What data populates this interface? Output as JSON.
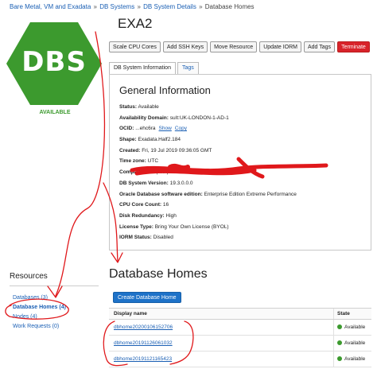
{
  "breadcrumb": {
    "items": [
      "Bare Metal, VM and Exadata",
      "DB Systems",
      "DB System Details",
      "Database Homes"
    ],
    "separator": "»"
  },
  "logo": {
    "text": "DBS",
    "state": "AVAILABLE",
    "color": "#3c9a2e"
  },
  "page_title": "EXA2",
  "toolbar": {
    "scale_cpu": "Scale CPU Cores",
    "add_ssh": "Add SSH Keys",
    "move_resource": "Move Resource",
    "update_iorm": "Update IORM",
    "add_tags": "Add Tags",
    "terminate": "Terminate"
  },
  "tabs": {
    "info": "DB System Information",
    "tags": "Tags"
  },
  "general": {
    "heading": "General Information",
    "rows": [
      {
        "key": "Status:",
        "value": "Available"
      },
      {
        "key": "Availability Domain:",
        "value": "suIt:UK-LONDON-1-AD-1"
      },
      {
        "key": "OCID:",
        "value": "...ehc6ra"
      },
      {
        "key": "Shape:",
        "value": "Exadata.Half2.184"
      },
      {
        "key": "Created:",
        "value": "Fri, 19 Jul 2019 09:36:05 GMT"
      },
      {
        "key": "Time zone:",
        "value": "UTC"
      },
      {
        "key": "Compartment:",
        "value": "(root)/"
      },
      {
        "key": "DB System Version:",
        "value": "19.3.0.0.0"
      },
      {
        "key": "Oracle Database software edition:",
        "value": "Enterprise Edition Extreme Performance"
      },
      {
        "key": "CPU Core Count:",
        "value": "16"
      },
      {
        "key": "Disk Redundancy:",
        "value": "High"
      },
      {
        "key": "License Type:",
        "value": "Bring Your Own License (BYOL)"
      },
      {
        "key": "IORM Status:",
        "value": "Disabled"
      }
    ],
    "ocid_show": "Show",
    "ocid_copy": "Copy"
  },
  "resources": {
    "title": "Resources",
    "items": [
      "Databases (3)",
      "Database Homes (4)",
      "Nodes (4)",
      "Work Requests (0)"
    ]
  },
  "db_homes": {
    "title": "Database Homes",
    "create": "Create Database Home",
    "col_name": "Display name",
    "col_state": "State",
    "rows": [
      {
        "name": "dbhome20200106152706",
        "state": "Available"
      },
      {
        "name": "dbhome20191126061032",
        "state": "Available"
      },
      {
        "name": "dbhome20191121165423",
        "state": "Available"
      }
    ]
  }
}
